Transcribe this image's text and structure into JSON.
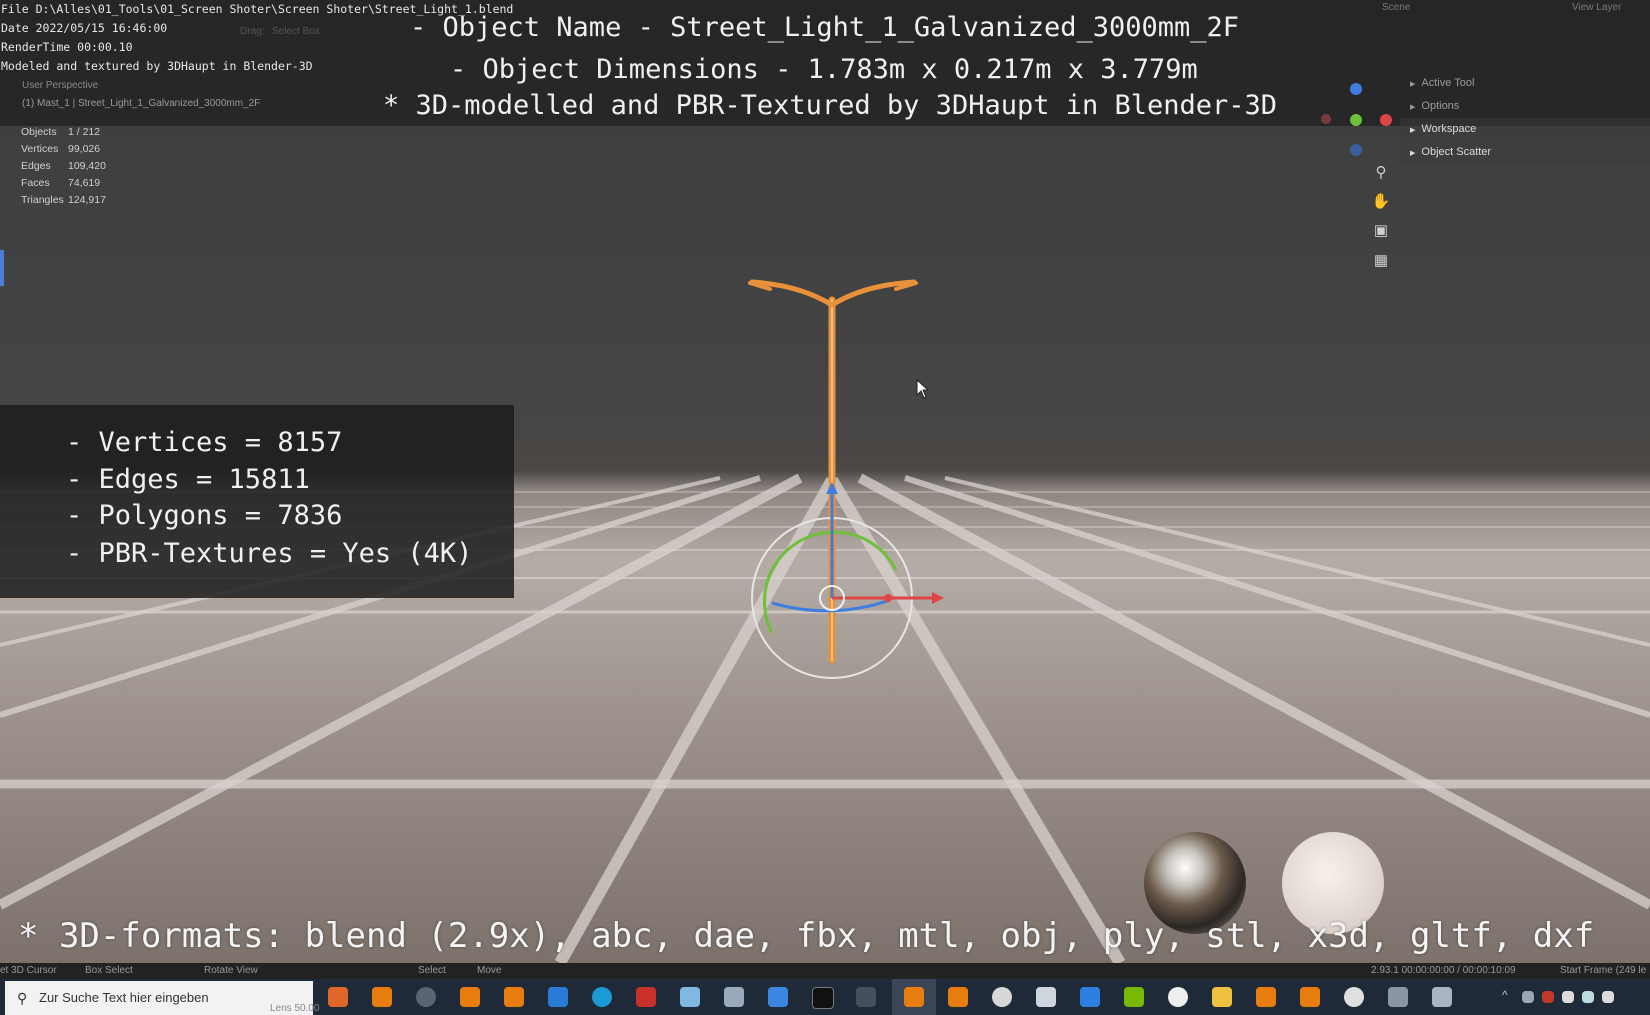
{
  "overlay": {
    "file_path": "File D:\\Alles\\01_Tools\\01_Screen Shoter\\Screen Shoter\\Street_Light_1.blend",
    "date": "Date 2022/05/15 16:46:00",
    "render_time": "RenderTime 00:00.10",
    "credit": "Modeled and textured by 3DHaupt in Blender-3D",
    "object_name": "- Object Name - Street_Light_1_Galvanized_3000mm_2F",
    "object_dimensions": "- Object Dimensions -  1.783m x 0.217m x 3.779m",
    "modelled_by": "* 3D-modelled and PBR-Textured by 3DHaupt in Blender-3D",
    "formats": "* 3D-formats: blend (2.9x), abc, dae, fbx, mtl, obj, ply, stl, x3d, gltf, dxf"
  },
  "viewport": {
    "mode": "User Perspective",
    "object_label": "(1) Mast_1 | Street_Light_1_Galvanized_3000mm_2F",
    "header_drag_label": "Drag:",
    "header_select_box": "Select Box",
    "stats": [
      {
        "label": "Objects",
        "value": "1 / 212"
      },
      {
        "label": "Vertices",
        "value": "99,026"
      },
      {
        "label": "Edges",
        "value": "109,420"
      },
      {
        "label": "Faces",
        "value": "74,619"
      },
      {
        "label": "Triangles",
        "value": "124,917"
      }
    ]
  },
  "info_box": {
    "vertices": "- Vertices = 8157",
    "edges": "- Edges = 15811",
    "polygons": "- Polygons = 7836",
    "pbr": "- PBR-Textures =  Yes (4K)"
  },
  "right_panel": {
    "items": [
      {
        "label": "Active Tool"
      },
      {
        "label": "Options"
      },
      {
        "label": "Workspace"
      },
      {
        "label": "Object Scatter"
      }
    ],
    "scene_label": "Scene",
    "view_layer_label": "View Layer"
  },
  "nav_icons": [
    "zoom-icon",
    "hand-icon",
    "camera-icon",
    "grid-icon"
  ],
  "status_bar": {
    "set_cursor": "et 3D Cursor",
    "box_select": "Box Select",
    "rotate_view": "Rotate View",
    "select": "Select",
    "move": "Move",
    "version_time": "2.93.1  00:00:00:00 / 00:00:10:09",
    "start_frame": "Start Frame (249 le"
  },
  "taskbar": {
    "search_placeholder": "Zur Suche Text hier eingeben",
    "lens": "Lens 50.00"
  },
  "colors": {
    "selection_orange": "#e8913a",
    "gizmo_red": "#e04545",
    "gizmo_green": "#6fbf3a",
    "gizmo_blue": "#3f7ee0",
    "taskbar_bg": "#1f2a38"
  }
}
